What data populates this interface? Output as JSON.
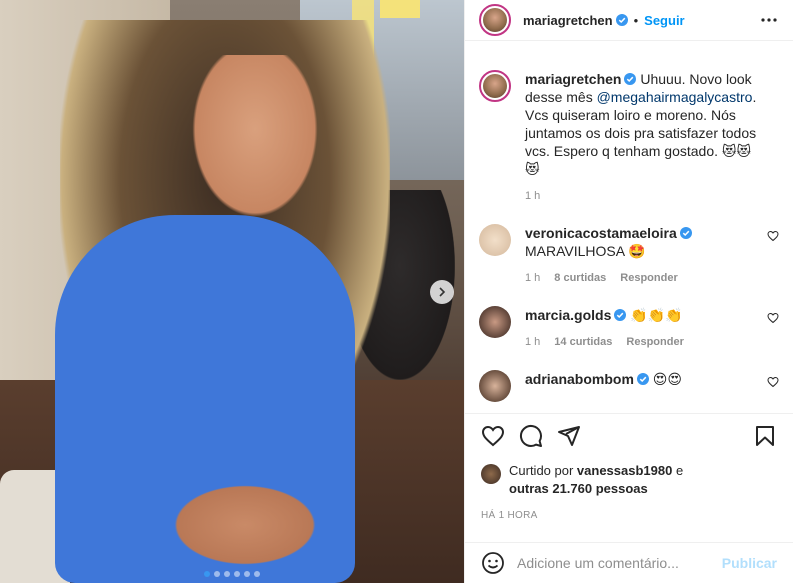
{
  "post": {
    "image": {
      "slides_total": 6,
      "current_slide": 1
    }
  },
  "header": {
    "username": "mariagretchen",
    "separator": "•",
    "follow_label": "Seguir"
  },
  "caption": {
    "username": "mariagretchen",
    "text_before": " Uhuuu. Novo look desse mês ",
    "mention": "@megahairmagalycastro",
    "text_after": ". Vcs quiseram loiro e moreno. Nós juntamos os dois pra satisfazer todos vcs. Espero q tenham gostado. 😻😻😻",
    "time": "1 h"
  },
  "comments": [
    {
      "username": "veronicacostamaeloira",
      "text": "MARAVILHOSA 🤩",
      "time": "1 h",
      "likes": "8 curtidas",
      "reply": "Responder",
      "verified": true
    },
    {
      "username": "marcia.golds",
      "text": " 👏👏👏",
      "time": "1 h",
      "likes": "14 curtidas",
      "reply": "Responder",
      "verified": true
    },
    {
      "username": "adrianabombom",
      "text": " 😍😍",
      "verified": true
    }
  ],
  "likes": {
    "prefix": "Curtido por ",
    "user": "vanessasb1980",
    "middle": " e",
    "others": "outras 21.760 pessoas"
  },
  "timestamp": "HÁ 1 HORA",
  "comment_box": {
    "placeholder": "Adicione um comentário...",
    "publish_label": "Publicar"
  },
  "colors": {
    "accent": "#0095f6",
    "verified": "#3897f0",
    "shirt": "#3f77d9"
  },
  "icons": [
    "chevron-right-icon",
    "verified-icon",
    "more-icon",
    "heart-icon",
    "comment-icon",
    "share-icon",
    "save-icon",
    "emoji-icon"
  ]
}
